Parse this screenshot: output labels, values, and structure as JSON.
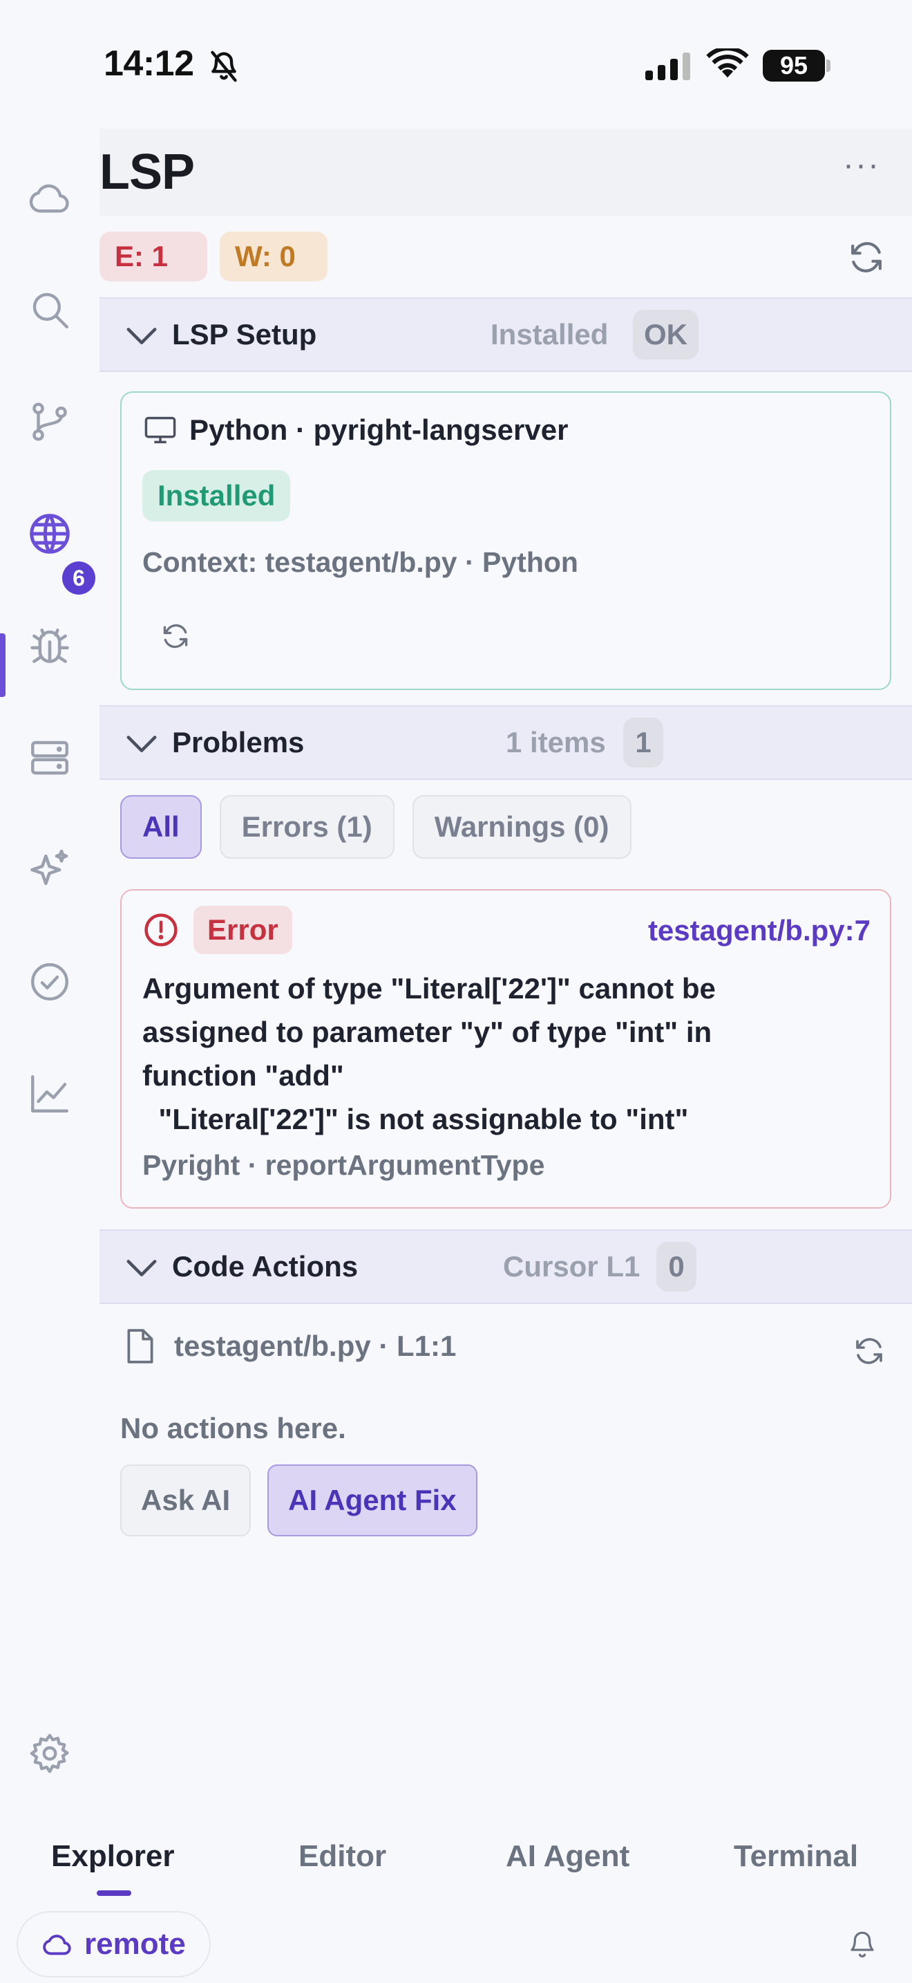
{
  "status_bar": {
    "time": "14:12",
    "battery": "95"
  },
  "sidebar": {
    "items": [
      {
        "icon": "cloud-icon"
      },
      {
        "icon": "search-icon"
      },
      {
        "icon": "source-control-icon",
        "badge": "6"
      },
      {
        "icon": "globe-icon",
        "active": true
      },
      {
        "icon": "bug-icon"
      },
      {
        "icon": "server-icon"
      },
      {
        "icon": "sparkle-icon"
      },
      {
        "icon": "check-circle-icon"
      },
      {
        "icon": "chart-icon"
      },
      {
        "icon": "gear-icon"
      }
    ]
  },
  "header": {
    "title": "LSP",
    "more": "···"
  },
  "counts": {
    "errors": "E: 1",
    "warnings": "W: 0"
  },
  "lsp_setup": {
    "title": "LSP Setup",
    "status": "Installed",
    "status_chip": "OK",
    "server": "Python · pyright-langserver",
    "installed_badge": "Installed",
    "context": "Context: testagent/b.py · Python"
  },
  "problems": {
    "title": "Problems",
    "count_text": "1 items",
    "count": "1",
    "filters": [
      "All",
      "Errors (1)",
      "Warnings (0)"
    ],
    "items": [
      {
        "severity": "Error",
        "location": "testagent/b.py:7",
        "message": "Argument of type \"Literal['22']\" cannot be\nassigned to parameter \"y\" of type \"int\" in\nfunction \"add\"\n  \"Literal['22']\" is not assignable to \"int\"",
        "source": "Pyright · reportArgumentType"
      }
    ]
  },
  "code_actions": {
    "title": "Code Actions",
    "cursor": "Cursor L1",
    "count": "0",
    "file": "testagent/b.py · L1:1",
    "empty": "No actions here.",
    "ask_ai": "Ask AI",
    "agent_fix": "AI Agent Fix"
  },
  "bottom_tabs": [
    "Explorer",
    "Editor",
    "AI Agent",
    "Terminal"
  ],
  "footer": {
    "remote": "remote"
  },
  "colors": {
    "accent": "#5b3bc4",
    "error": "#c6303f",
    "warning": "#c07a24",
    "success": "#1f9a74"
  }
}
